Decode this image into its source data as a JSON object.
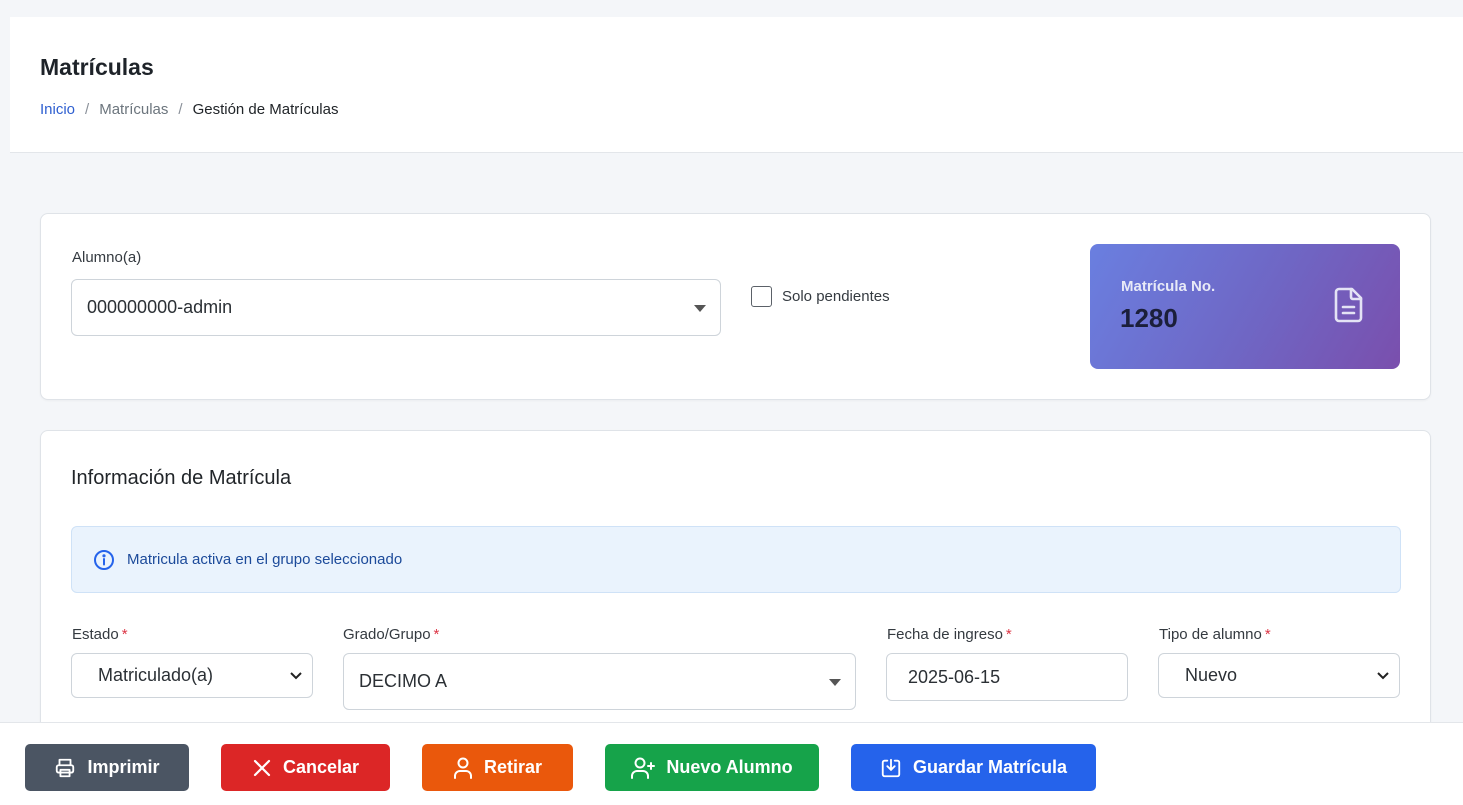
{
  "header": {
    "title": "Matrículas",
    "breadcrumb": [
      "Inicio",
      "Matrículas",
      "Gestión de Matrículas"
    ],
    "separator": "/"
  },
  "student_card": {
    "label": "Alumno(a)",
    "selected": "000000000-admin",
    "checkbox_label": "Solo pendientes",
    "checkbox_checked": false,
    "matricula_label": "Matrícula No.",
    "matricula_number": "1280",
    "icon": "document-icon"
  },
  "info_card": {
    "title": "Información de Matrícula",
    "alert": "Matricula activa en el grupo seleccionado",
    "fields": {
      "estado": {
        "label": "Estado",
        "value": "Matriculado(a)"
      },
      "grado": {
        "label": "Grado/Grupo",
        "value": "DECIMO A"
      },
      "fecha": {
        "label": "Fecha de ingreso",
        "value": "2025-06-15"
      },
      "tipo": {
        "label": "Tipo de alumno",
        "value": "Nuevo"
      }
    },
    "required_mark": "*"
  },
  "actions": {
    "print": "Imprimir",
    "cancel": "Cancelar",
    "retire": "Retirar",
    "new_student": "Nuevo Alumno",
    "save": "Guardar Matrícula"
  },
  "colors": {
    "print": "#4b5563",
    "cancel": "#dc2626",
    "retire": "#ea580c",
    "new_student": "#16a34a",
    "save": "#2563eb",
    "link": "#2e5fd0"
  }
}
